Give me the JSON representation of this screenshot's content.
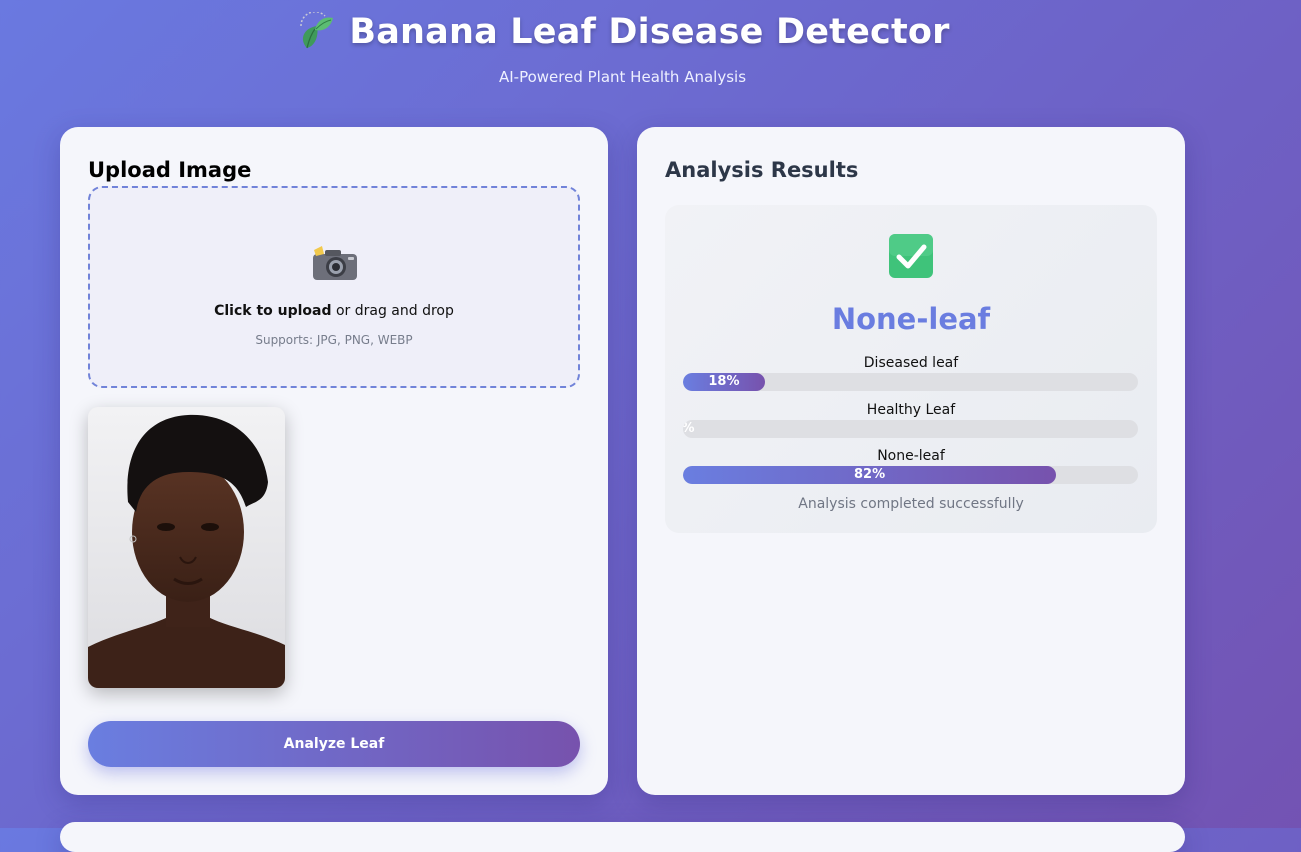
{
  "header": {
    "title": "Banana Leaf Disease Detector",
    "subtitle": "AI-Powered Plant Health Analysis",
    "logo_icon": "leaf-icon"
  },
  "upload": {
    "title": "Upload Image",
    "click_text": "Click to upload",
    "drag_text": " or drag and drop",
    "supports": "Supports: JPG, PNG, WEBP",
    "icon": "camera-icon",
    "analyze_label": "Analyze Leaf"
  },
  "results": {
    "title": "Analysis Results",
    "status_icon": "check-icon",
    "prediction": "None-leaf",
    "bars": [
      {
        "label": "Diseased leaf",
        "percent_text": "18%",
        "value": 18
      },
      {
        "label": "Healthy Leaf",
        "percent_text": "%",
        "value": 0
      },
      {
        "label": "None-leaf",
        "percent_text": "82%",
        "value": 82
      }
    ],
    "status": "Analysis completed successfully"
  },
  "colors": {
    "accent_start": "#6a7ee0",
    "accent_end": "#7752ad",
    "check_green": "#3fc37a"
  }
}
